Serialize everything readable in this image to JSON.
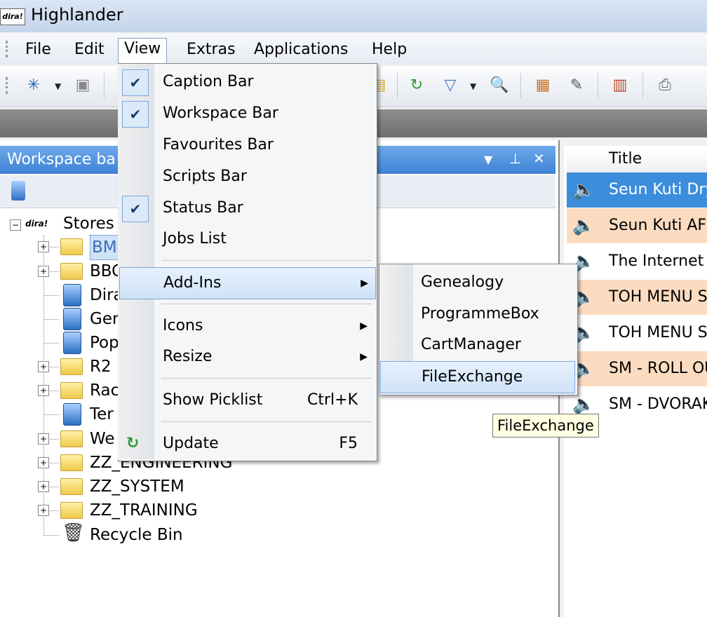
{
  "window": {
    "title": "Highlander",
    "logo_text": "dira!"
  },
  "menubar": {
    "items": [
      "File",
      "Edit",
      "View",
      "Extras",
      "Applications",
      "Help"
    ]
  },
  "workspace": {
    "title": "Workspace ba",
    "tree_root": {
      "logo_text": "dira!",
      "label": "Stores"
    },
    "tree": [
      {
        "label": "BM",
        "icon": "folder-icon",
        "expandable": true,
        "selected": true
      },
      {
        "label": "BBC",
        "icon": "folder-icon",
        "expandable": true
      },
      {
        "label": "Dira",
        "icon": "store-icon",
        "expandable": false
      },
      {
        "label": "Ger",
        "icon": "store-icon",
        "expandable": false
      },
      {
        "label": "Pop",
        "icon": "store-icon",
        "expandable": false
      },
      {
        "label": "R2",
        "icon": "folder-icon",
        "expandable": true
      },
      {
        "label": "Rac",
        "icon": "folder-icon",
        "expandable": true
      },
      {
        "label": "Ter",
        "icon": "store-icon",
        "expandable": false
      },
      {
        "label": "We",
        "icon": "folder-icon",
        "expandable": true
      },
      {
        "label": "ZZ_ENGINEERING",
        "icon": "folder-icon",
        "expandable": true
      },
      {
        "label": "ZZ_SYSTEM",
        "icon": "folder-icon",
        "expandable": true
      },
      {
        "label": "ZZ_TRAINING",
        "icon": "folder-icon",
        "expandable": true
      },
      {
        "label": "Recycle Bin",
        "icon": "trash-icon",
        "expandable": false
      }
    ]
  },
  "list": {
    "column_title": "Title",
    "rows": [
      {
        "title": "Seun Kuti Dry",
        "style": "selected"
      },
      {
        "title": "Seun Kuti AFR",
        "style": "orange"
      },
      {
        "title": "The Internet V",
        "style": "plain"
      },
      {
        "title": "TOH MENU S",
        "style": "orange"
      },
      {
        "title": "TOH MENU S",
        "style": "plain"
      },
      {
        "title": "SM - ROLL OU",
        "style": "orange"
      },
      {
        "title": "SM - DVORAK",
        "style": "plain"
      }
    ]
  },
  "view_menu": {
    "items": [
      {
        "label": "Caption Bar",
        "checked": true
      },
      {
        "label": "Workspace Bar",
        "checked": true
      },
      {
        "label": "Favourites Bar",
        "checked": false
      },
      {
        "label": "Scripts Bar",
        "checked": false
      },
      {
        "label": "Status Bar",
        "checked": true
      },
      {
        "label": "Jobs List",
        "checked": false
      },
      {
        "label": "Add-Ins",
        "submenu": true,
        "highlighted": true
      },
      {
        "label": "Icons",
        "submenu": true
      },
      {
        "label": "Resize",
        "submenu": true
      },
      {
        "label": "Show Picklist",
        "shortcut": "Ctrl+K"
      },
      {
        "label": "Update",
        "shortcut": "F5",
        "icon": "refresh-icon"
      }
    ]
  },
  "addins_menu": {
    "items": [
      {
        "label": "Genealogy"
      },
      {
        "label": "ProgrammeBox"
      },
      {
        "label": "CartManager"
      },
      {
        "label": "FileExchange",
        "highlighted": true
      }
    ]
  },
  "tooltip": {
    "text": "FileExchange"
  },
  "colors": {
    "accent": "#3e82d6",
    "orange_row": "#fbdcc0",
    "selected_row": "#3c8ddc"
  }
}
